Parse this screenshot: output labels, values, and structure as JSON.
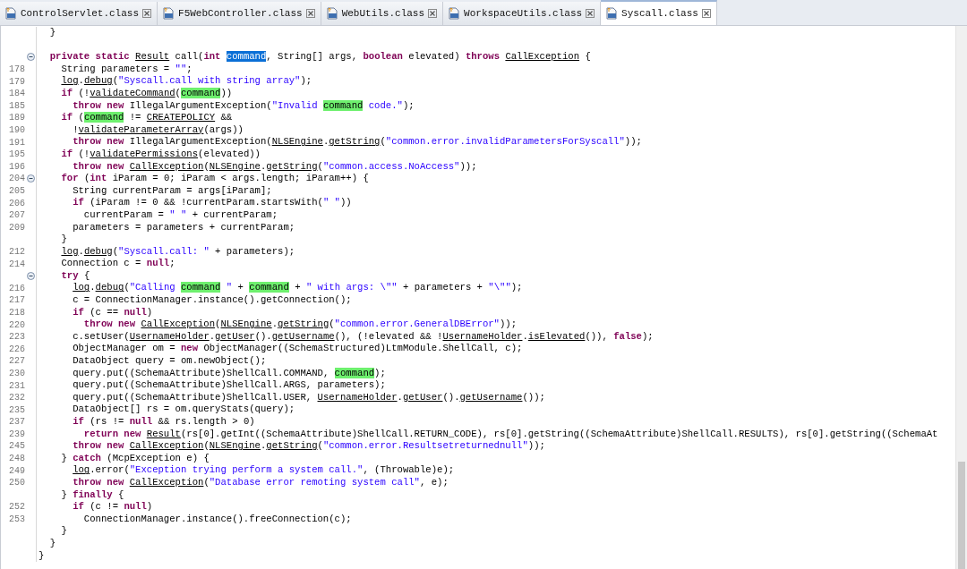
{
  "tabs": [
    {
      "label": "ControlServlet.class",
      "selected": false
    },
    {
      "label": "F5WebController.class",
      "selected": false
    },
    {
      "label": "WebUtils.class",
      "selected": false
    },
    {
      "label": "WorkspaceUtils.class",
      "selected": false
    },
    {
      "label": "Syscall.class",
      "selected": true
    }
  ],
  "editor": {
    "lines": [
      {
        "collapsible": false,
        "tokens": [
          {
            "kind": "plain",
            "text": "  }"
          }
        ]
      },
      {
        "collapsible": false
      },
      {
        "collapsible": true,
        "tokens": [
          {
            "kind": "keyword",
            "text": "  private static "
          },
          {
            "kind": "link",
            "text": "Result"
          },
          {
            "kind": "plain",
            "text": " call("
          },
          {
            "kind": "keyword",
            "text": "int "
          },
          {
            "kind": "selection",
            "text": "command"
          },
          {
            "kind": "plain",
            "text": ", String[] args, "
          },
          {
            "kind": "keyword",
            "text": "boolean"
          },
          {
            "kind": "plain",
            "text": " elevated) "
          },
          {
            "kind": "keyword",
            "text": "throws "
          },
          {
            "kind": "link",
            "text": "CallException"
          },
          {
            "kind": "plain",
            "text": " {"
          }
        ]
      },
      {
        "number": "178",
        "collapsible": false,
        "tokens": [
          {
            "kind": "plain",
            "text": "    String parameters = "
          },
          {
            "kind": "string",
            "text": "\"\""
          },
          {
            "kind": "plain",
            "text": ";"
          }
        ]
      },
      {
        "number": "179",
        "collapsible": false,
        "tokens": [
          {
            "kind": "link",
            "text": "    log"
          },
          {
            "kind": "plain",
            "text": "."
          },
          {
            "kind": "link",
            "text": "debug"
          },
          {
            "kind": "plain",
            "text": "("
          },
          {
            "kind": "string",
            "text": "\"Syscall.call with string array\""
          },
          {
            "kind": "plain",
            "text": ");"
          }
        ]
      },
      {
        "number": "184",
        "collapsible": false,
        "tokens": [
          {
            "kind": "keyword",
            "text": "    if"
          },
          {
            "kind": "plain",
            "text": " (!"
          },
          {
            "kind": "link",
            "text": "validateCommand"
          },
          {
            "kind": "plain",
            "text": "("
          },
          {
            "kind": "match",
            "text": "command"
          },
          {
            "kind": "plain",
            "text": "))"
          }
        ]
      },
      {
        "number": "185",
        "collapsible": false,
        "tokens": [
          {
            "kind": "keyword",
            "text": "      throw new"
          },
          {
            "kind": "plain",
            "text": " IllegalArgumentException("
          },
          {
            "kind": "string",
            "text": "\"Invalid "
          },
          {
            "kind": "match",
            "text": "command"
          },
          {
            "kind": "string",
            "text": " code.\""
          },
          {
            "kind": "plain",
            "text": ");"
          }
        ]
      },
      {
        "number": "189",
        "collapsible": false,
        "tokens": [
          {
            "kind": "keyword",
            "text": "    if"
          },
          {
            "kind": "plain",
            "text": " ("
          },
          {
            "kind": "match",
            "text": "command"
          },
          {
            "kind": "plain",
            "text": " != "
          },
          {
            "kind": "link",
            "text": "CREATEPOLICY"
          },
          {
            "kind": "plain",
            "text": " &&"
          }
        ]
      },
      {
        "number": "190",
        "collapsible": false,
        "tokens": [
          {
            "kind": "plain",
            "text": "      !"
          },
          {
            "kind": "link",
            "text": "validateParameterArray"
          },
          {
            "kind": "plain",
            "text": "(args))"
          }
        ]
      },
      {
        "number": "191",
        "collapsible": false,
        "tokens": [
          {
            "kind": "keyword",
            "text": "      throw new"
          },
          {
            "kind": "plain",
            "text": " IllegalArgumentException("
          },
          {
            "kind": "link",
            "text": "NLSEngine"
          },
          {
            "kind": "plain",
            "text": "."
          },
          {
            "kind": "link",
            "text": "getString"
          },
          {
            "kind": "plain",
            "text": "("
          },
          {
            "kind": "string",
            "text": "\"common.error.invalidParametersForSyscall\""
          },
          {
            "kind": "plain",
            "text": "));"
          }
        ]
      },
      {
        "number": "195",
        "collapsible": false,
        "tokens": [
          {
            "kind": "keyword",
            "text": "    if"
          },
          {
            "kind": "plain",
            "text": " (!"
          },
          {
            "kind": "link",
            "text": "validatePermissions"
          },
          {
            "kind": "plain",
            "text": "(elevated))"
          }
        ]
      },
      {
        "number": "196",
        "collapsible": false,
        "tokens": [
          {
            "kind": "keyword",
            "text": "      throw new "
          },
          {
            "kind": "link",
            "text": "CallException"
          },
          {
            "kind": "plain",
            "text": "("
          },
          {
            "kind": "link",
            "text": "NLSEngine"
          },
          {
            "kind": "plain",
            "text": "."
          },
          {
            "kind": "link",
            "text": "getString"
          },
          {
            "kind": "plain",
            "text": "("
          },
          {
            "kind": "string",
            "text": "\"common.access.NoAccess\""
          },
          {
            "kind": "plain",
            "text": "));"
          }
        ]
      },
      {
        "number": "204",
        "collapsible": true,
        "tokens": [
          {
            "kind": "keyword",
            "text": "    for"
          },
          {
            "kind": "plain",
            "text": " ("
          },
          {
            "kind": "keyword",
            "text": "int"
          },
          {
            "kind": "plain",
            "text": " iParam = 0; iParam < args.length; iParam++) {"
          }
        ]
      },
      {
        "number": "205",
        "collapsible": false,
        "tokens": [
          {
            "kind": "plain",
            "text": "      String currentParam = args[iParam];"
          }
        ]
      },
      {
        "number": "206",
        "collapsible": false,
        "tokens": [
          {
            "kind": "keyword",
            "text": "      if"
          },
          {
            "kind": "plain",
            "text": " (iParam != 0 && !currentParam.startsWith("
          },
          {
            "kind": "string",
            "text": "\" \""
          },
          {
            "kind": "plain",
            "text": "))"
          }
        ]
      },
      {
        "number": "207",
        "collapsible": false,
        "tokens": [
          {
            "kind": "plain",
            "text": "        currentParam = "
          },
          {
            "kind": "string",
            "text": "\" \""
          },
          {
            "kind": "plain",
            "text": " + currentParam;"
          }
        ]
      },
      {
        "number": "209",
        "collapsible": false,
        "tokens": [
          {
            "kind": "plain",
            "text": "      parameters = parameters + currentParam;"
          }
        ]
      },
      {
        "collapsible": false,
        "tokens": [
          {
            "kind": "plain",
            "text": "    }"
          }
        ]
      },
      {
        "number": "212",
        "collapsible": false,
        "tokens": [
          {
            "kind": "link",
            "text": "    log"
          },
          {
            "kind": "plain",
            "text": "."
          },
          {
            "kind": "link",
            "text": "debug"
          },
          {
            "kind": "plain",
            "text": "("
          },
          {
            "kind": "string",
            "text": "\"Syscall.call: \""
          },
          {
            "kind": "plain",
            "text": " + parameters);"
          }
        ]
      },
      {
        "number": "214",
        "collapsible": false,
        "tokens": [
          {
            "kind": "plain",
            "text": "    Connection c = "
          },
          {
            "kind": "keyword",
            "text": "null"
          },
          {
            "kind": "plain",
            "text": ";"
          }
        ]
      },
      {
        "collapsible": true,
        "tokens": [
          {
            "kind": "keyword",
            "text": "    try"
          },
          {
            "kind": "plain",
            "text": " {"
          }
        ]
      },
      {
        "number": "216",
        "collapsible": false,
        "tokens": [
          {
            "kind": "link",
            "text": "      log"
          },
          {
            "kind": "plain",
            "text": "."
          },
          {
            "kind": "link",
            "text": "debug"
          },
          {
            "kind": "plain",
            "text": "("
          },
          {
            "kind": "string",
            "text": "\"Calling "
          },
          {
            "kind": "match",
            "text": "command"
          },
          {
            "kind": "string",
            "text": " \""
          },
          {
            "kind": "plain",
            "text": " + "
          },
          {
            "kind": "match",
            "text": "command"
          },
          {
            "kind": "plain",
            "text": " + "
          },
          {
            "kind": "string",
            "text": "\" with args: \\\"\""
          },
          {
            "kind": "plain",
            "text": " + parameters + "
          },
          {
            "kind": "string",
            "text": "\"\\\"\""
          },
          {
            "kind": "plain",
            "text": ");"
          }
        ]
      },
      {
        "number": "217",
        "collapsible": false,
        "tokens": [
          {
            "kind": "plain",
            "text": "      c = ConnectionManager.instance().getConnection();"
          }
        ]
      },
      {
        "number": "218",
        "collapsible": false,
        "tokens": [
          {
            "kind": "keyword",
            "text": "      if"
          },
          {
            "kind": "plain",
            "text": " (c == "
          },
          {
            "kind": "keyword",
            "text": "null"
          },
          {
            "kind": "plain",
            "text": ")"
          }
        ]
      },
      {
        "number": "220",
        "collapsible": false,
        "tokens": [
          {
            "kind": "keyword",
            "text": "        throw new "
          },
          {
            "kind": "link",
            "text": "CallException"
          },
          {
            "kind": "plain",
            "text": "("
          },
          {
            "kind": "link",
            "text": "NLSEngine"
          },
          {
            "kind": "plain",
            "text": "."
          },
          {
            "kind": "link",
            "text": "getString"
          },
          {
            "kind": "plain",
            "text": "("
          },
          {
            "kind": "string",
            "text": "\"common.error.GeneralDBError\""
          },
          {
            "kind": "plain",
            "text": "));"
          }
        ]
      },
      {
        "number": "223",
        "collapsible": false,
        "tokens": [
          {
            "kind": "plain",
            "text": "      c.setUser("
          },
          {
            "kind": "link",
            "text": "UsernameHolder"
          },
          {
            "kind": "plain",
            "text": "."
          },
          {
            "kind": "link",
            "text": "getUser"
          },
          {
            "kind": "plain",
            "text": "()."
          },
          {
            "kind": "link",
            "text": "getUsername"
          },
          {
            "kind": "plain",
            "text": "(), (!elevated && !"
          },
          {
            "kind": "link",
            "text": "UsernameHolder"
          },
          {
            "kind": "plain",
            "text": "."
          },
          {
            "kind": "link",
            "text": "isElevated"
          },
          {
            "kind": "plain",
            "text": "()), "
          },
          {
            "kind": "keyword",
            "text": "false"
          },
          {
            "kind": "plain",
            "text": ");"
          }
        ]
      },
      {
        "number": "226",
        "collapsible": false,
        "tokens": [
          {
            "kind": "plain",
            "text": "      ObjectManager om = "
          },
          {
            "kind": "keyword",
            "text": "new"
          },
          {
            "kind": "plain",
            "text": " ObjectManager((SchemaStructured)LtmModule.ShellCall, c);"
          }
        ]
      },
      {
        "number": "227",
        "collapsible": false,
        "tokens": [
          {
            "kind": "plain",
            "text": "      DataObject query = om.newObject();"
          }
        ]
      },
      {
        "number": "230",
        "collapsible": false,
        "tokens": [
          {
            "kind": "plain",
            "text": "      query.put((SchemaAttribute)ShellCall.COMMAND, "
          },
          {
            "kind": "match",
            "text": "command"
          },
          {
            "kind": "plain",
            "text": ");"
          }
        ]
      },
      {
        "number": "231",
        "collapsible": false,
        "tokens": [
          {
            "kind": "plain",
            "text": "      query.put((SchemaAttribute)ShellCall.ARGS, parameters);"
          }
        ]
      },
      {
        "number": "232",
        "collapsible": false,
        "tokens": [
          {
            "kind": "plain",
            "text": "      query.put((SchemaAttribute)ShellCall.USER, "
          },
          {
            "kind": "link",
            "text": "UsernameHolder"
          },
          {
            "kind": "plain",
            "text": "."
          },
          {
            "kind": "link",
            "text": "getUser"
          },
          {
            "kind": "plain",
            "text": "()."
          },
          {
            "kind": "link",
            "text": "getUsername"
          },
          {
            "kind": "plain",
            "text": "());"
          }
        ]
      },
      {
        "number": "235",
        "collapsible": false,
        "tokens": [
          {
            "kind": "plain",
            "text": "      DataObject[] rs = om.queryStats(query);"
          }
        ]
      },
      {
        "number": "237",
        "collapsible": false,
        "tokens": [
          {
            "kind": "keyword",
            "text": "      if"
          },
          {
            "kind": "plain",
            "text": " (rs != "
          },
          {
            "kind": "keyword",
            "text": "null"
          },
          {
            "kind": "plain",
            "text": " && rs.length > 0)"
          }
        ]
      },
      {
        "number": "239",
        "collapsible": false,
        "tokens": [
          {
            "kind": "keyword",
            "text": "        return new "
          },
          {
            "kind": "link",
            "text": "Result"
          },
          {
            "kind": "plain",
            "text": "(rs[0].getInt((SchemaAttribute)ShellCall.RETURN_CODE), rs[0].getString((SchemaAttribute)ShellCall.RESULTS), rs[0].getString((SchemaAt"
          }
        ]
      },
      {
        "number": "245",
        "collapsible": false,
        "tokens": [
          {
            "kind": "keyword",
            "text": "      throw new "
          },
          {
            "kind": "link",
            "text": "CallException"
          },
          {
            "kind": "plain",
            "text": "("
          },
          {
            "kind": "link",
            "text": "NLSEngine"
          },
          {
            "kind": "plain",
            "text": "."
          },
          {
            "kind": "link",
            "text": "getString"
          },
          {
            "kind": "plain",
            "text": "("
          },
          {
            "kind": "string",
            "text": "\"common.error.Resultsetreturnednull\""
          },
          {
            "kind": "plain",
            "text": "));"
          }
        ]
      },
      {
        "number": "248",
        "collapsible": false,
        "tokens": [
          {
            "kind": "plain",
            "text": "    } "
          },
          {
            "kind": "keyword",
            "text": "catch"
          },
          {
            "kind": "plain",
            "text": " (McpException e) {"
          }
        ]
      },
      {
        "number": "249",
        "collapsible": false,
        "tokens": [
          {
            "kind": "link",
            "text": "      log"
          },
          {
            "kind": "plain",
            "text": ".error("
          },
          {
            "kind": "string",
            "text": "\"Exception trying perform a system call.\""
          },
          {
            "kind": "plain",
            "text": ", (Throwable)e);"
          }
        ]
      },
      {
        "number": "250",
        "collapsible": false,
        "tokens": [
          {
            "kind": "keyword",
            "text": "      throw new "
          },
          {
            "kind": "link",
            "text": "CallException"
          },
          {
            "kind": "plain",
            "text": "("
          },
          {
            "kind": "string",
            "text": "\"Database error remoting system call\""
          },
          {
            "kind": "plain",
            "text": ", e);"
          }
        ]
      },
      {
        "collapsible": false,
        "tokens": [
          {
            "kind": "plain",
            "text": "    } "
          },
          {
            "kind": "keyword",
            "text": "finally"
          },
          {
            "kind": "plain",
            "text": " {"
          }
        ]
      },
      {
        "number": "252",
        "collapsible": false,
        "tokens": [
          {
            "kind": "keyword",
            "text": "      if"
          },
          {
            "kind": "plain",
            "text": " (c != "
          },
          {
            "kind": "keyword",
            "text": "null"
          },
          {
            "kind": "plain",
            "text": ")"
          }
        ]
      },
      {
        "number": "253",
        "collapsible": false,
        "tokens": [
          {
            "kind": "plain",
            "text": "        ConnectionManager.instance().freeConnection(c);"
          }
        ]
      },
      {
        "collapsible": false,
        "tokens": [
          {
            "kind": "plain",
            "text": "    }"
          }
        ]
      },
      {
        "collapsible": false,
        "tokens": [
          {
            "kind": "plain",
            "text": "  }"
          }
        ]
      },
      {
        "collapsible": false,
        "tokens": [
          {
            "kind": "plain",
            "text": "}"
          }
        ]
      }
    ]
  }
}
